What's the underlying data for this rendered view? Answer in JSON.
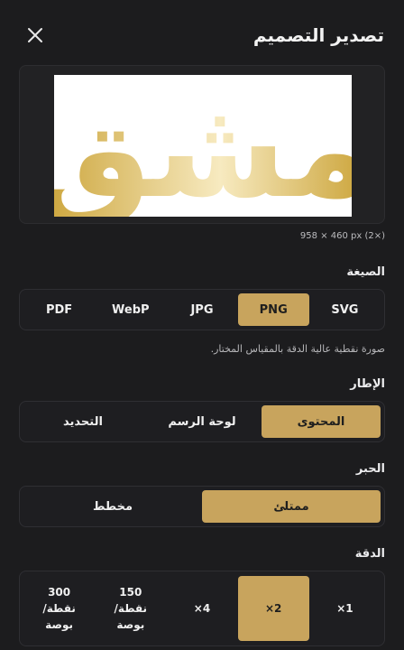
{
  "header": {
    "title": "تصدير التصميم"
  },
  "preview": {
    "artwork_text": "مشق",
    "dims": "958 × 460 px (2×)"
  },
  "format": {
    "label": "الصيغة",
    "options": [
      "SVG",
      "PNG",
      "JPG",
      "WebP",
      "PDF"
    ],
    "selected": "PNG",
    "hint": "صورة نقطية عالية الدقة بالمقياس المختار."
  },
  "frame": {
    "label": "الإطار",
    "options": [
      "المحتوى",
      "لوحة الرسم",
      "التحديد"
    ],
    "selected": "المحتوى"
  },
  "ink": {
    "label": "الحبر",
    "options": [
      "ممتلئ",
      "مخطط"
    ],
    "selected": "ممتلئ"
  },
  "resolution": {
    "label": "الدقة",
    "options": [
      "1×",
      "2×",
      "4×",
      "150\nنقطة/\nبوصة",
      "300\nنقطة/\nبوصة"
    ],
    "selected": "2×"
  },
  "colors": {
    "accent": "#c8a45d",
    "background": "#1c1c1e",
    "gold_dark": "#c9a032",
    "gold_light": "#f7eac0"
  }
}
